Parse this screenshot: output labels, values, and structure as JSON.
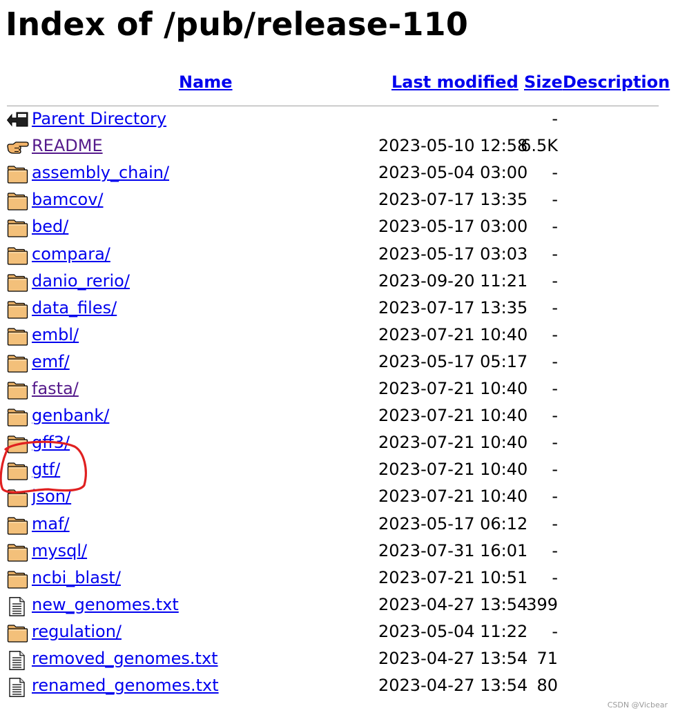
{
  "page": {
    "title": "Index of /pub/release-110"
  },
  "table": {
    "headers": {
      "name": "Name",
      "last_modified": "Last modified",
      "size": "Size",
      "description": "Description"
    },
    "rows": [
      {
        "icon": "back-icon",
        "name": "Parent Directory",
        "modified": "",
        "size": "-",
        "visited": false
      },
      {
        "icon": "hand-pointer-icon",
        "name": "README",
        "modified": "2023-05-10 12:58",
        "size": "6.5K",
        "visited": true
      },
      {
        "icon": "folder-icon",
        "name": "assembly_chain/",
        "modified": "2023-05-04 03:00",
        "size": "-",
        "visited": false
      },
      {
        "icon": "folder-icon",
        "name": "bamcov/",
        "modified": "2023-07-17 13:35",
        "size": "-",
        "visited": false
      },
      {
        "icon": "folder-icon",
        "name": "bed/",
        "modified": "2023-05-17 03:00",
        "size": "-",
        "visited": false
      },
      {
        "icon": "folder-icon",
        "name": "compara/",
        "modified": "2023-05-17 03:03",
        "size": "-",
        "visited": false
      },
      {
        "icon": "folder-icon",
        "name": "danio_rerio/",
        "modified": "2023-09-20 11:21",
        "size": "-",
        "visited": false
      },
      {
        "icon": "folder-icon",
        "name": "data_files/",
        "modified": "2023-07-17 13:35",
        "size": "-",
        "visited": false
      },
      {
        "icon": "folder-icon",
        "name": "embl/",
        "modified": "2023-07-21 10:40",
        "size": "-",
        "visited": false
      },
      {
        "icon": "folder-icon",
        "name": "emf/",
        "modified": "2023-05-17 05:17",
        "size": "-",
        "visited": false
      },
      {
        "icon": "folder-icon",
        "name": "fasta/",
        "modified": "2023-07-21 10:40",
        "size": "-",
        "visited": true
      },
      {
        "icon": "folder-icon",
        "name": "genbank/",
        "modified": "2023-07-21 10:40",
        "size": "-",
        "visited": false
      },
      {
        "icon": "folder-icon",
        "name": "gff3/",
        "modified": "2023-07-21 10:40",
        "size": "-",
        "visited": false
      },
      {
        "icon": "folder-icon",
        "name": "gtf/",
        "modified": "2023-07-21 10:40",
        "size": "-",
        "visited": false
      },
      {
        "icon": "folder-icon",
        "name": "json/",
        "modified": "2023-07-21 10:40",
        "size": "-",
        "visited": false
      },
      {
        "icon": "folder-icon",
        "name": "maf/",
        "modified": "2023-05-17 06:12",
        "size": "-",
        "visited": false
      },
      {
        "icon": "folder-icon",
        "name": "mysql/",
        "modified": "2023-07-31 16:01",
        "size": "-",
        "visited": false
      },
      {
        "icon": "folder-icon",
        "name": "ncbi_blast/",
        "modified": "2023-07-21 10:51",
        "size": "-",
        "visited": false
      },
      {
        "icon": "text-file-icon",
        "name": "new_genomes.txt",
        "modified": "2023-04-27 13:54",
        "size": "399",
        "visited": false
      },
      {
        "icon": "folder-icon",
        "name": "regulation/",
        "modified": "2023-05-04 11:22",
        "size": "-",
        "visited": false
      },
      {
        "icon": "text-file-icon",
        "name": "removed_genomes.txt",
        "modified": "2023-04-27 13:54",
        "size": "71",
        "visited": false
      },
      {
        "icon": "text-file-icon",
        "name": "renamed_genomes.txt",
        "modified": "2023-04-27 13:54",
        "size": "80",
        "visited": false
      }
    ]
  },
  "colors": {
    "link": "#0000ee",
    "visited_link": "#551a8b",
    "folder": "#f3c07a",
    "annotation": "#e02020"
  },
  "watermark": "CSDN @Vicbear"
}
